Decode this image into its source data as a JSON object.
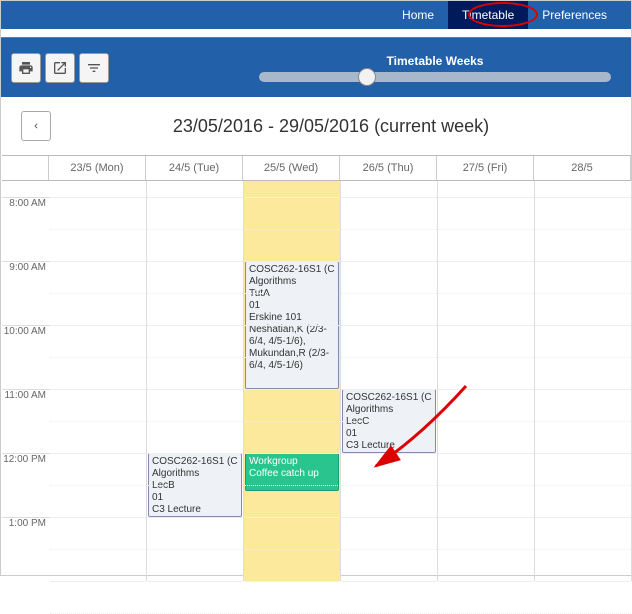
{
  "nav": {
    "home": "Home",
    "timetable": "Timetable",
    "preferences": "Preferences"
  },
  "toolbar": {
    "slider_label": "Timetable Weeks"
  },
  "date_header": {
    "title": "23/05/2016 - 29/05/2016 (current week)"
  },
  "days": [
    "23/5 (Mon)",
    "24/5 (Tue)",
    "25/5 (Wed)",
    "26/5 (Thu)",
    "27/5 (Fri)",
    "28/5"
  ],
  "times": [
    "8:00 AM",
    "9:00 AM",
    "10:00 AM",
    "11:00 AM",
    "12:00 PM",
    "1:00 PM"
  ],
  "events": {
    "wed_cosc262_tut": "COSC262-16S1 (C\nAlgorithms\nTutA\n01\nErskine 101\nNeshatian,K (2/3-6/4, 4/5-1/6), Mukundan,R (2/3-6/4, 4/5-1/6)",
    "wed_workgroup": "Workgroup\nCoffee catch up",
    "tue_cosc262_lecb": "COSC262-16S1 (C\nAlgorithms\nLecB\n01\nC3 Lecture",
    "thu_cosc262_lecc": "COSC262-16S1 (C\nAlgorithms\nLecC\n01\nC3 Lecture"
  }
}
